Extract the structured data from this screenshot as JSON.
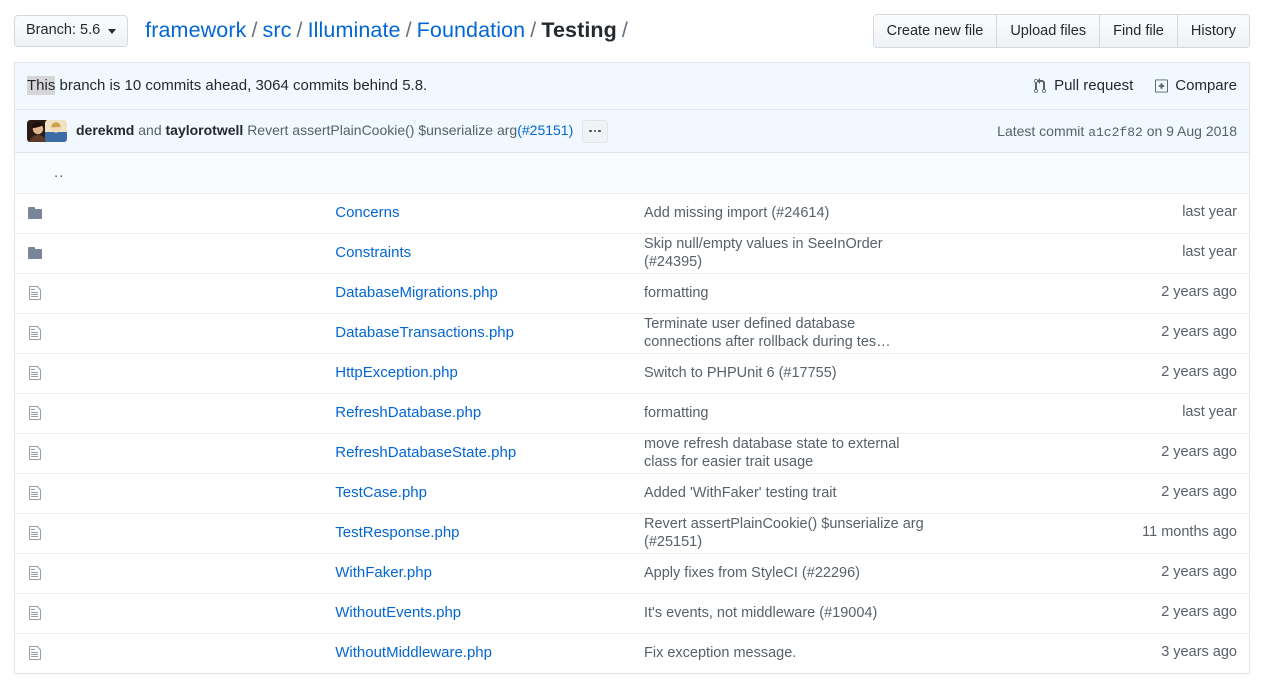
{
  "toolbar": {
    "branch_label": "Branch: 5.6",
    "breadcrumb": {
      "repo": "framework",
      "parts": [
        "src",
        "Illuminate",
        "Foundation"
      ],
      "current": "Testing",
      "separator": "/"
    },
    "actions": [
      "Create new file",
      "Upload files",
      "Find file",
      "History"
    ]
  },
  "branch_status": {
    "highlighted_word": "This",
    "text": " branch is 10 commits ahead, 3064 commits behind 5.8.",
    "pull_request_label": "Pull request",
    "compare_label": "Compare"
  },
  "latest_commit": {
    "author_primary": "derekmd",
    "conjunction": "and",
    "author_secondary": "taylorotwell",
    "message": "Revert assertPlainCookie() $unserialize arg",
    "issue": "(#25151)",
    "expand_label": "...",
    "meta_prefix": "Latest commit",
    "sha": "a1c2f82",
    "meta_suffix": "on 9 Aug 2018"
  },
  "file_list": {
    "up_dir": "..",
    "rows": [
      {
        "type": "folder",
        "name": "Concerns",
        "message": "Add missing import (#24614)",
        "age": "last year"
      },
      {
        "type": "folder",
        "name": "Constraints",
        "message": "Skip null/empty values in SeeInOrder (#24395)",
        "age": "last year"
      },
      {
        "type": "file",
        "name": "DatabaseMigrations.php",
        "message": "formatting",
        "age": "2 years ago"
      },
      {
        "type": "file",
        "name": "DatabaseTransactions.php",
        "message": "Terminate user defined database connections after rollback during tes…",
        "age": "2 years ago"
      },
      {
        "type": "file",
        "name": "HttpException.php",
        "message": "Switch to PHPUnit 6 (#17755)",
        "age": "2 years ago"
      },
      {
        "type": "file",
        "name": "RefreshDatabase.php",
        "message": "formatting",
        "age": "last year"
      },
      {
        "type": "file",
        "name": "RefreshDatabaseState.php",
        "message": "move refresh database state to external class for easier trait usage",
        "age": "2 years ago"
      },
      {
        "type": "file",
        "name": "TestCase.php",
        "message": "Added 'WithFaker' testing trait",
        "age": "2 years ago"
      },
      {
        "type": "file",
        "name": "TestResponse.php",
        "message": "Revert assertPlainCookie() $unserialize arg (#25151)",
        "age": "11 months ago"
      },
      {
        "type": "file",
        "name": "WithFaker.php",
        "message": "Apply fixes from StyleCI (#22296)",
        "age": "2 years ago"
      },
      {
        "type": "file",
        "name": "WithoutEvents.php",
        "message": "It's events, not middleware (#19004)",
        "age": "2 years ago"
      },
      {
        "type": "file",
        "name": "WithoutMiddleware.php",
        "message": "Fix exception message.",
        "age": "3 years ago"
      }
    ]
  },
  "colors": {
    "link": "#0366d6",
    "text": "#24292e",
    "muted": "#586069",
    "folder_icon": "#79869a",
    "file_icon": "#959da5",
    "info_bg": "#f1f8ff",
    "border": "#e1e4e8"
  }
}
